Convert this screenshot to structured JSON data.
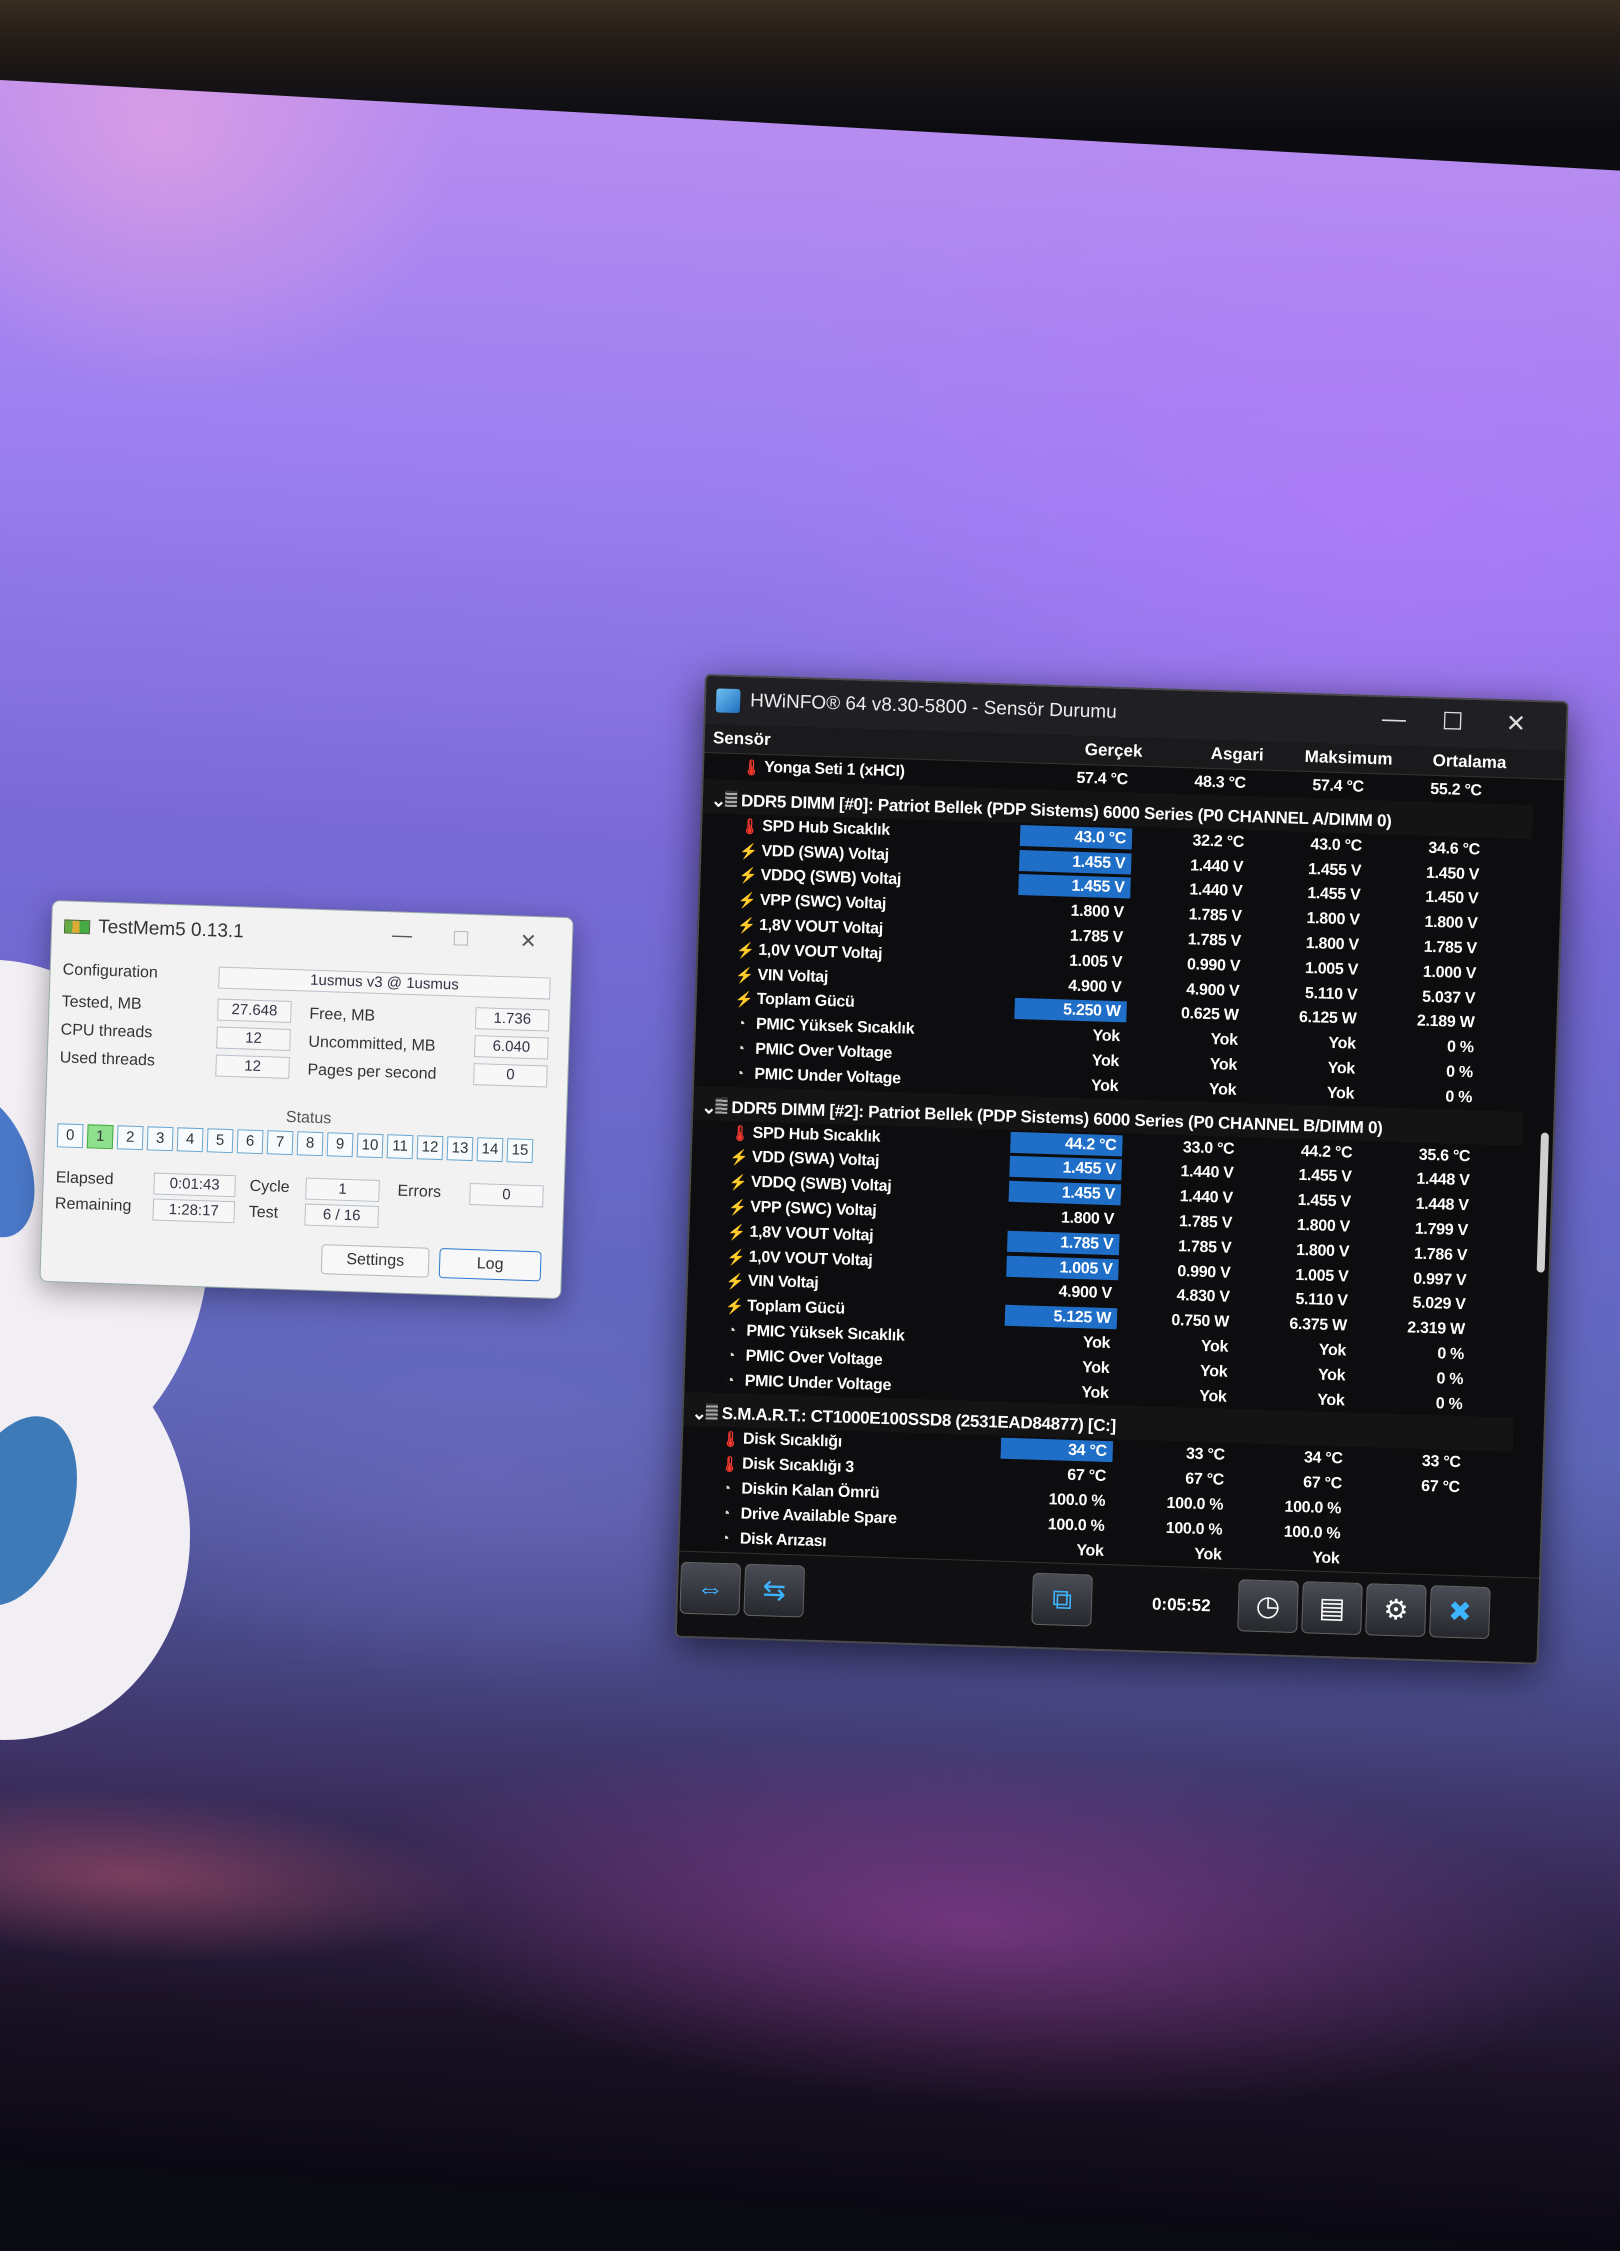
{
  "testmem": {
    "title": "TestMem5  0.13.1",
    "configuration_label": "Configuration",
    "configuration_value": "1usmus v3 @ 1usmus",
    "tested_label": "Tested, MB",
    "tested_value": "27.648",
    "free_label": "Free, MB",
    "free_value": "1.736",
    "cpu_threads_label": "CPU threads",
    "cpu_threads_value": "12",
    "uncommitted_label": "Uncommitted, MB",
    "uncommitted_value": "6.040",
    "used_threads_label": "Used threads",
    "used_threads_value": "12",
    "pages_label": "Pages per second",
    "pages_value": "0",
    "status_label": "Status",
    "status_cells": [
      "0",
      "1",
      "2",
      "3",
      "4",
      "5",
      "6",
      "7",
      "8",
      "9",
      "10",
      "11",
      "12",
      "13",
      "14",
      "15"
    ],
    "status_active_index": 1,
    "elapsed_label": "Elapsed",
    "elapsed_value": "0:01:43",
    "cycle_label": "Cycle",
    "cycle_value": "1",
    "errors_label": "Errors",
    "errors_value": "0",
    "remaining_label": "Remaining",
    "remaining_value": "1:28:17",
    "test_label": "Test",
    "test_value": "6 / 16",
    "settings_button": "Settings",
    "log_button": "Log"
  },
  "hwinfo": {
    "title": "HWiNFO® 64 v8.30-5800 - Sensör Durumu",
    "columns": {
      "sensor": "Sensör",
      "current": "Gerçek",
      "min": "Asgari",
      "max": "Maksimum",
      "avg": "Ortalama"
    },
    "rows": [
      {
        "kind": "item",
        "icon": "temp",
        "name": "Yonga Seti 1 (xHCI)",
        "cur": "57.4 °C",
        "min": "48.3 °C",
        "max": "57.4 °C",
        "avg": "55.2 °C",
        "hl": false
      },
      {
        "kind": "group",
        "name": "DDR5 DIMM [#0]: Patriot Bellek (PDP Sistems) 6000 Series (P0 CHANNEL A/DIMM 0)"
      },
      {
        "kind": "item",
        "icon": "temp",
        "name": "SPD Hub Sıcaklık",
        "cur": "43.0 °C",
        "min": "32.2 °C",
        "max": "43.0 °C",
        "avg": "34.6 °C",
        "hl": true
      },
      {
        "kind": "item",
        "icon": "volt",
        "name": "VDD (SWA) Voltaj",
        "cur": "1.455 V",
        "min": "1.440 V",
        "max": "1.455 V",
        "avg": "1.450 V",
        "hl": true
      },
      {
        "kind": "item",
        "icon": "volt",
        "name": "VDDQ (SWB) Voltaj",
        "cur": "1.455 V",
        "min": "1.440 V",
        "max": "1.455 V",
        "avg": "1.450 V",
        "hl": true
      },
      {
        "kind": "item",
        "icon": "volt",
        "name": "VPP (SWC) Voltaj",
        "cur": "1.800 V",
        "min": "1.785 V",
        "max": "1.800 V",
        "avg": "1.800 V",
        "hl": false
      },
      {
        "kind": "item",
        "icon": "volt",
        "name": "1,8V VOUT Voltaj",
        "cur": "1.785 V",
        "min": "1.785 V",
        "max": "1.800 V",
        "avg": "1.785 V",
        "hl": false
      },
      {
        "kind": "item",
        "icon": "volt",
        "name": "1,0V VOUT Voltaj",
        "cur": "1.005 V",
        "min": "0.990 V",
        "max": "1.005 V",
        "avg": "1.000 V",
        "hl": false
      },
      {
        "kind": "item",
        "icon": "volt",
        "name": "VIN Voltaj",
        "cur": "4.900 V",
        "min": "4.900 V",
        "max": "5.110 V",
        "avg": "5.037 V",
        "hl": false
      },
      {
        "kind": "item",
        "icon": "volt",
        "name": "Toplam Gücü",
        "cur": "5.250 W",
        "min": "0.625 W",
        "max": "6.125 W",
        "avg": "2.189 W",
        "hl": true
      },
      {
        "kind": "item",
        "icon": "gauge",
        "name": "PMIC Yüksek Sıcaklık",
        "cur": "Yok",
        "min": "Yok",
        "max": "Yok",
        "avg": "0 %",
        "hl": false
      },
      {
        "kind": "item",
        "icon": "gauge",
        "name": "PMIC Over Voltage",
        "cur": "Yok",
        "min": "Yok",
        "max": "Yok",
        "avg": "0 %",
        "hl": false
      },
      {
        "kind": "item",
        "icon": "gauge",
        "name": "PMIC Under Voltage",
        "cur": "Yok",
        "min": "Yok",
        "max": "Yok",
        "avg": "0 %",
        "hl": false
      },
      {
        "kind": "group",
        "name": "DDR5 DIMM [#2]: Patriot Bellek (PDP Sistems) 6000 Series (P0 CHANNEL B/DIMM 0)"
      },
      {
        "kind": "item",
        "icon": "temp",
        "name": "SPD Hub Sıcaklık",
        "cur": "44.2 °C",
        "min": "33.0 °C",
        "max": "44.2 °C",
        "avg": "35.6 °C",
        "hl": true
      },
      {
        "kind": "item",
        "icon": "volt",
        "name": "VDD (SWA) Voltaj",
        "cur": "1.455 V",
        "min": "1.440 V",
        "max": "1.455 V",
        "avg": "1.448 V",
        "hl": true
      },
      {
        "kind": "item",
        "icon": "volt",
        "name": "VDDQ (SWB) Voltaj",
        "cur": "1.455 V",
        "min": "1.440 V",
        "max": "1.455 V",
        "avg": "1.448 V",
        "hl": true
      },
      {
        "kind": "item",
        "icon": "volt",
        "name": "VPP (SWC) Voltaj",
        "cur": "1.800 V",
        "min": "1.785 V",
        "max": "1.800 V",
        "avg": "1.799 V",
        "hl": false
      },
      {
        "kind": "item",
        "icon": "volt",
        "name": "1,8V VOUT Voltaj",
        "cur": "1.785 V",
        "min": "1.785 V",
        "max": "1.800 V",
        "avg": "1.786 V",
        "hl": true
      },
      {
        "kind": "item",
        "icon": "volt",
        "name": "1,0V VOUT Voltaj",
        "cur": "1.005 V",
        "min": "0.990 V",
        "max": "1.005 V",
        "avg": "0.997 V",
        "hl": true
      },
      {
        "kind": "item",
        "icon": "volt",
        "name": "VIN Voltaj",
        "cur": "4.900 V",
        "min": "4.830 V",
        "max": "5.110 V",
        "avg": "5.029 V",
        "hl": false
      },
      {
        "kind": "item",
        "icon": "volt",
        "name": "Toplam Gücü",
        "cur": "5.125 W",
        "min": "0.750 W",
        "max": "6.375 W",
        "avg": "2.319 W",
        "hl": true
      },
      {
        "kind": "item",
        "icon": "gauge",
        "name": "PMIC Yüksek Sıcaklık",
        "cur": "Yok",
        "min": "Yok",
        "max": "Yok",
        "avg": "0 %",
        "hl": false
      },
      {
        "kind": "item",
        "icon": "gauge",
        "name": "PMIC Over Voltage",
        "cur": "Yok",
        "min": "Yok",
        "max": "Yok",
        "avg": "0 %",
        "hl": false
      },
      {
        "kind": "item",
        "icon": "gauge",
        "name": "PMIC Under Voltage",
        "cur": "Yok",
        "min": "Yok",
        "max": "Yok",
        "avg": "0 %",
        "hl": false
      },
      {
        "kind": "group",
        "name": "S.M.A.R.T.: CT1000E100SSD8 (2531EAD84877) [C:]"
      },
      {
        "kind": "item",
        "icon": "temp",
        "name": "Disk Sıcaklığı",
        "cur": "34 °C",
        "min": "33 °C",
        "max": "34 °C",
        "avg": "33 °C",
        "hl": true
      },
      {
        "kind": "item",
        "icon": "temp",
        "name": "Disk Sıcaklığı 3",
        "cur": "67 °C",
        "min": "67 °C",
        "max": "67 °C",
        "avg": "67 °C",
        "hl": false
      },
      {
        "kind": "item",
        "icon": "gauge",
        "name": "Diskin Kalan Ömrü",
        "cur": "100.0 %",
        "min": "100.0 %",
        "max": "100.0 %",
        "avg": "",
        "hl": false
      },
      {
        "kind": "item",
        "icon": "gauge",
        "name": "Drive Available Spare",
        "cur": "100.0 %",
        "min": "100.0 %",
        "max": "100.0 %",
        "avg": "",
        "hl": false
      },
      {
        "kind": "item",
        "icon": "gauge",
        "name": "Disk Arızası",
        "cur": "Yok",
        "min": "Yok",
        "max": "Yok",
        "avg": "",
        "hl": false
      }
    ],
    "timer": "0:05:52",
    "toolbar_icons": [
      "expand-arrows-icon",
      "collapse-arrows-icon",
      "network-icon",
      "clock-icon",
      "report-icon",
      "settings-gear-icon",
      "close-x-icon"
    ]
  }
}
